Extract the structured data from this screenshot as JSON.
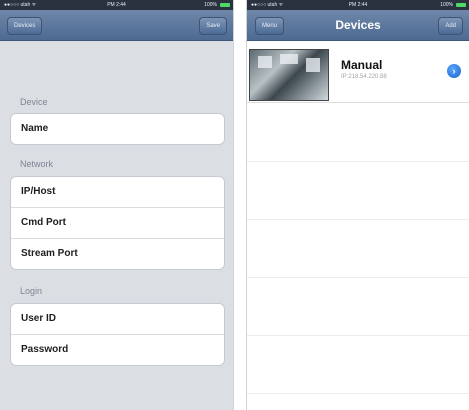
{
  "left_screen": {
    "status_bar": {
      "carrier": "●●○○○ utah ᯤ",
      "time": "PM 2:44",
      "battery": "100%"
    },
    "nav": {
      "back_label": "Devices",
      "save_label": "Save"
    },
    "sections": {
      "device": {
        "header": "Device",
        "fields": [
          "Name"
        ]
      },
      "network": {
        "header": "Network",
        "fields": [
          "IP/Host",
          "Cmd Port",
          "Stream Port"
        ]
      },
      "login": {
        "header": "Login",
        "fields": [
          "User ID",
          "Password"
        ]
      }
    }
  },
  "right_screen": {
    "status_bar": {
      "carrier": "●●○○○ utah ᯤ",
      "time": "PM 2:44",
      "battery": "100%"
    },
    "nav": {
      "title": "Devices",
      "menu_label": "Menu",
      "add_label": "Add"
    },
    "devices": [
      {
        "name": "Manual",
        "ip": "IP:218.54.220.88",
        "disclosure_icon": "disclosure-arrow-icon"
      }
    ]
  },
  "colors": {
    "nav_bar": "#5a769c",
    "form_background": "#dbdee3",
    "disclosure": "#1d63c9",
    "battery": "#4cd964"
  }
}
